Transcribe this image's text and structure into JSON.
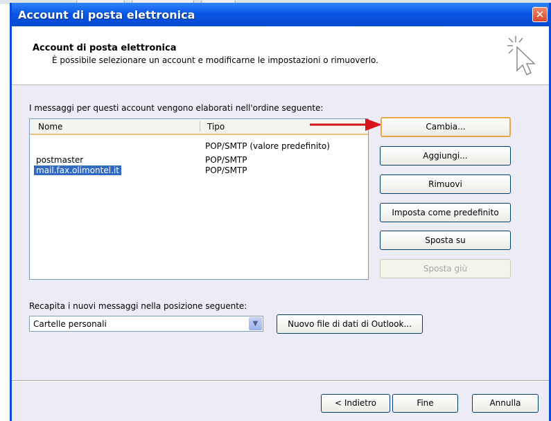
{
  "window": {
    "title": "Account di posta elettronica",
    "close_glyph": "✕"
  },
  "header": {
    "title": "Account di posta elettronica",
    "subtitle": "È possibile selezionare un account e modificarne le impostazioni o rimuoverlo.",
    "icon": "cursor-sparkle-icon"
  },
  "accounts": {
    "caption": "I messaggi per questi account vengono elaborati nell'ordine seguente:",
    "columns": [
      "Nome",
      "Tipo"
    ],
    "rows": [
      {
        "name": "",
        "type": "POP/SMTP (valore predefinito)"
      },
      {
        "name": "postmaster",
        "type": "POP/SMTP"
      },
      {
        "name": "mail.fax.olimontel.it",
        "type": "POP/SMTP",
        "selected": true
      }
    ]
  },
  "buttons": {
    "change": "Cambia...",
    "add": "Aggiungi...",
    "remove": "Rimuovi",
    "set_default": "Imposta come predefinito",
    "move_up": "Sposta su",
    "move_down": "Sposta giù"
  },
  "delivery": {
    "caption": "Recapita i nuovi messaggi nella posizione seguente:",
    "selected": "Cartelle personali",
    "new_file": "Nuovo file di dati di Outlook..."
  },
  "footer": {
    "back": "< Indietro",
    "finish": "Fine",
    "cancel": "Annulla"
  },
  "colors": {
    "titlebar": "#0a57e6",
    "selection": "#316ac5",
    "annotation_arrow": "#d6141c",
    "dialog_bg": "#ecebf6"
  }
}
